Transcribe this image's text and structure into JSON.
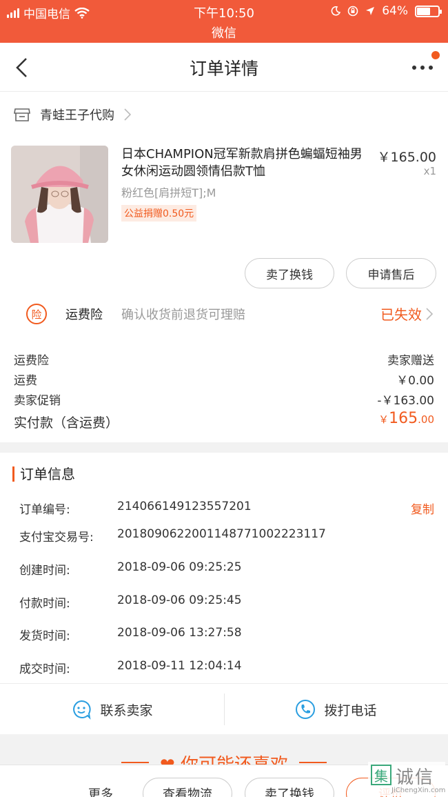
{
  "status_bar": {
    "carrier": "中国电信",
    "time": "下午10:50",
    "app": "微信",
    "battery": "64%",
    "battery_level": 0.64
  },
  "nav": {
    "title": "订单详情"
  },
  "shop": {
    "name": "青蛙王子代购"
  },
  "product": {
    "title": "日本CHAMPION冠军新款肩拼色蝙蝠短袖男女休闲运动圆领情侣款T恤",
    "price": "￥165.00",
    "qty": "x1",
    "sku": "粉红色[肩拼短T];M",
    "charity": "公益捐赠0.50元"
  },
  "item_buttons": {
    "sell": "卖了换钱",
    "after_sale": "申请售后"
  },
  "insurance": {
    "badge": "险",
    "name": "运费险",
    "desc": "确认收货前退货可理赔",
    "status": "已失效"
  },
  "fees": [
    {
      "label": "运费险",
      "value": "卖家赠送"
    },
    {
      "label": "运费",
      "value": "￥0.00"
    },
    {
      "label": "卖家促销",
      "value": "-￥163.00"
    }
  ],
  "total": {
    "label": "实付款（含运费）",
    "currency": "￥",
    "int": "165",
    "dec": ".00"
  },
  "order_info": {
    "title": "订单信息",
    "copy": "复制",
    "rows": [
      {
        "label": "订单编号:",
        "value": "214066149123557201"
      },
      {
        "label": "支付宝交易号:",
        "value": "2018090622001148771002223117"
      },
      {
        "label": "创建时间:",
        "value": "2018-09-06 09:25:25"
      },
      {
        "label": "付款时间:",
        "value": "2018-09-06 09:25:45"
      },
      {
        "label": "发货时间:",
        "value": "2018-09-06 13:27:58"
      },
      {
        "label": "成交时间:",
        "value": "2018-09-11 12:04:14"
      }
    ]
  },
  "contact": {
    "seller": "联系卖家",
    "call": "拨打电话"
  },
  "recommend": {
    "title": "你可能还喜欢"
  },
  "bottom_bar": {
    "more": "更多",
    "logistics": "查看物流",
    "sell": "卖了换钱",
    "review": "评价"
  },
  "watermark": {
    "mark": "集",
    "text": "诚信",
    "sub": "JiChengXin.com"
  },
  "colors": {
    "accent": "#f15a1e",
    "status_bar": "#f15a3a"
  }
}
